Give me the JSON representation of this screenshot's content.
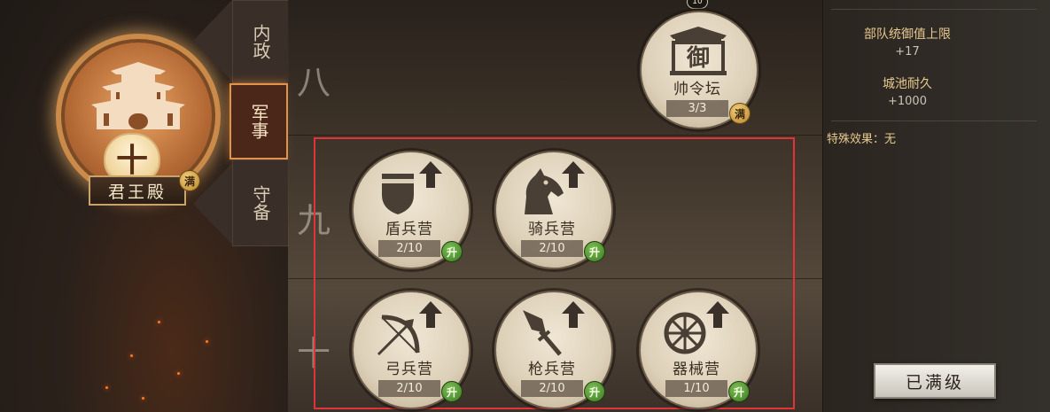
{
  "hall": {
    "level": "十",
    "name": "君王殿",
    "max_badge": "满"
  },
  "tabs": [
    {
      "label": "内政",
      "active": false
    },
    {
      "label": "军事",
      "active": true
    },
    {
      "label": "守备",
      "active": false
    }
  ],
  "rows": [
    {
      "label": "八"
    },
    {
      "label": "九"
    },
    {
      "label": "十"
    }
  ],
  "buildings": [
    {
      "name": "帅令坛",
      "count": "3/3",
      "badge": "满",
      "level_tag": "10",
      "icon_text": "御"
    },
    {
      "name": "盾兵营",
      "count": "2/10",
      "badge": "升"
    },
    {
      "name": "骑兵营",
      "count": "2/10",
      "badge": "升"
    },
    {
      "name": "弓兵营",
      "count": "2/10",
      "badge": "升"
    },
    {
      "name": "枪兵营",
      "count": "2/10",
      "badge": "升"
    },
    {
      "name": "器械营",
      "count": "1/10",
      "badge": "升"
    }
  ],
  "info": {
    "stat1_title": "部队统御值上限",
    "stat1_value": "+17",
    "stat2_title": "城池耐久",
    "stat2_value": "+1000",
    "special": "特殊效果：无"
  },
  "action_button": "已满级",
  "colors": {
    "highlight": "#e0343a",
    "upgrade_badge": "#3a7a22",
    "max_badge": "#b7822c"
  }
}
